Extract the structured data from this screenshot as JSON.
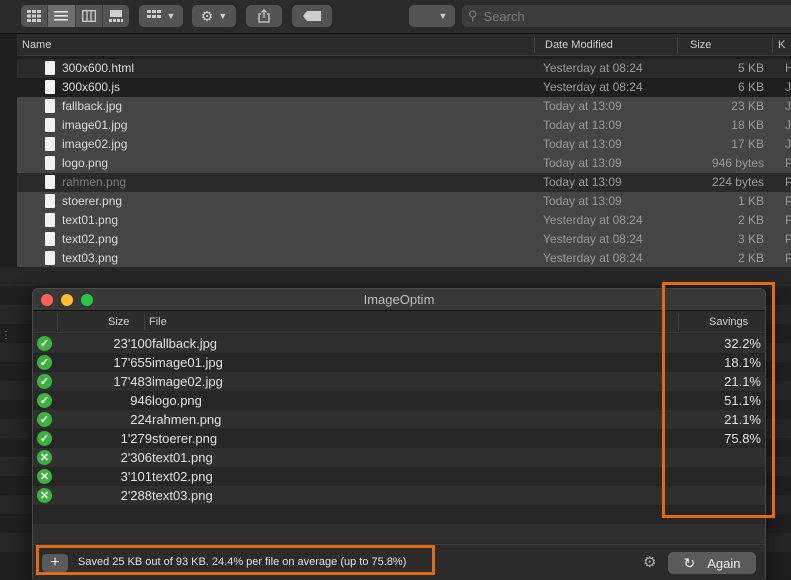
{
  "toolbar": {
    "search_placeholder": "Search",
    "view_buttons": [
      "icon-view",
      "list-view",
      "column-view",
      "gallery-view"
    ]
  },
  "finder": {
    "columns": {
      "name": "Name",
      "date": "Date Modified",
      "size": "Size",
      "kind": "K"
    },
    "files": [
      {
        "name": "300x600.html",
        "date": "Yesterday at 08:24",
        "size": "5 KB",
        "kind": "H"
      },
      {
        "name": "300x600.js",
        "date": "Yesterday at 08:24",
        "size": "6 KB",
        "kind": "J"
      },
      {
        "name": "fallback.jpg",
        "date": "Today at 13:09",
        "size": "23 KB",
        "kind": "J"
      },
      {
        "name": "image01.jpg",
        "date": "Today at 13:09",
        "size": "18 KB",
        "kind": "J"
      },
      {
        "name": "image02.jpg",
        "date": "Today at 13:09",
        "size": "17 KB",
        "kind": "J"
      },
      {
        "name": "logo.png",
        "date": "Today at 13:09",
        "size": "946 bytes",
        "kind": "P"
      },
      {
        "name": "rahmen.png",
        "date": "Today at 13:09",
        "size": "224 bytes",
        "kind": "P"
      },
      {
        "name": "stoerer.png",
        "date": "Today at 13:09",
        "size": "1 KB",
        "kind": "P"
      },
      {
        "name": "text01.png",
        "date": "Yesterday at 08:24",
        "size": "2 KB",
        "kind": "P"
      },
      {
        "name": "text02.png",
        "date": "Yesterday at 08:24",
        "size": "3 KB",
        "kind": "P"
      },
      {
        "name": "text03.png",
        "date": "Yesterday at 08:24",
        "size": "2 KB",
        "kind": "P"
      }
    ]
  },
  "imageoptim": {
    "title": "ImageOptim",
    "columns": {
      "size": "Size",
      "file": "File",
      "savings": "Savings"
    },
    "rows": [
      {
        "status": "ok",
        "size": "23'100",
        "file": "fallback.jpg",
        "savings": "32.2%"
      },
      {
        "status": "ok",
        "size": "17'655",
        "file": "image01.jpg",
        "savings": "18.1%"
      },
      {
        "status": "ok",
        "size": "17'483",
        "file": "image02.jpg",
        "savings": "21.1%"
      },
      {
        "status": "ok",
        "size": "946",
        "file": "logo.png",
        "savings": "51.1%"
      },
      {
        "status": "ok",
        "size": "224",
        "file": "rahmen.png",
        "savings": "21.1%"
      },
      {
        "status": "ok",
        "size": "1'279",
        "file": "stoerer.png",
        "savings": "75.8%"
      },
      {
        "status": "err",
        "size": "2'306",
        "file": "text01.png",
        "savings": ""
      },
      {
        "status": "err",
        "size": "3'101",
        "file": "text02.png",
        "savings": ""
      },
      {
        "status": "err",
        "size": "2'288",
        "file": "text03.png",
        "savings": ""
      }
    ],
    "footer_text": "Saved 25 KB out of 93 KB. 24.4% per file on average (up to 75.8%)",
    "plus_label": "+",
    "again_label": "Again"
  },
  "colors": {
    "highlight": "#e26b10",
    "success": "#3bb23d",
    "close": "#ff5f57",
    "minimize": "#febc2e",
    "zoom": "#28c840"
  }
}
